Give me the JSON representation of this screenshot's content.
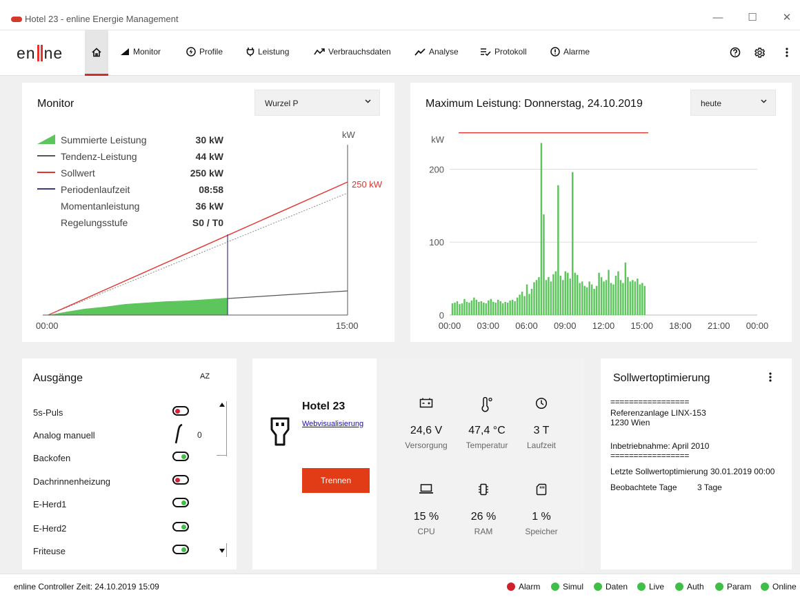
{
  "window": {
    "title": "Hotel 23 - enline Energie Management"
  },
  "nav": {
    "logo_left": "en",
    "logo_right": "ne",
    "items": [
      {
        "label": "Monitor"
      },
      {
        "label": "Profile"
      },
      {
        "label": "Leistung"
      },
      {
        "label": "Verbrauchsdaten"
      },
      {
        "label": "Analyse"
      },
      {
        "label": "Protokoll"
      },
      {
        "label": "Alarme"
      }
    ]
  },
  "monitor": {
    "title": "Monitor",
    "select_value": "Wurzel P",
    "legend": [
      {
        "label": "Summierte Leistung",
        "value": "30 kW"
      },
      {
        "label": "Tendenz-Leistung",
        "value": "44 kW"
      },
      {
        "label": "Sollwert",
        "value": "250 kW"
      },
      {
        "label": "Periodenlaufzeit",
        "value": "08:58"
      },
      {
        "label": "Momentanleistung",
        "value": "36 kW"
      },
      {
        "label": "Regelungsstufe",
        "value": "S0 / T0"
      }
    ],
    "unit": "kW",
    "setpoint_label": "250 kW",
    "x_start": "00:00",
    "x_end": "15:00"
  },
  "max_chart": {
    "title": "Maximum Leistung: Donnerstag, 24.10.2019",
    "select_value": "heute"
  },
  "chart_data": {
    "type": "bar",
    "ylabel": "kW",
    "ylim": [
      0,
      260
    ],
    "y_ticks": [
      "0",
      "100",
      "200"
    ],
    "y_tick_values": [
      0,
      100,
      200
    ],
    "x_ticks": [
      "00:00",
      "03:00",
      "06:00",
      "09:00",
      "12:00",
      "15:00",
      "18:00",
      "21:00",
      "00:00"
    ],
    "x_range_hours": [
      0,
      24
    ],
    "setpoint": 250,
    "setpoint_range_hours": [
      0,
      15.5
    ],
    "values": [
      16,
      17,
      19,
      15,
      16,
      22,
      18,
      17,
      20,
      24,
      21,
      18,
      19,
      17,
      16,
      20,
      22,
      18,
      17,
      21,
      19,
      16,
      18,
      17,
      20,
      21,
      19,
      24,
      28,
      32,
      26,
      42,
      29,
      36,
      45,
      48,
      52,
      236,
      138,
      48,
      52,
      46,
      56,
      60,
      178,
      54,
      48,
      60,
      58,
      50,
      196,
      58,
      55,
      44,
      46,
      40,
      38,
      46,
      42,
      36,
      40,
      58,
      52,
      46,
      48,
      62,
      44,
      42,
      54,
      60,
      48,
      44,
      72,
      52,
      46,
      48,
      46,
      50,
      42,
      44,
      40
    ],
    "bar_hours_start": 0.15,
    "bar_hours_step": 0.1875,
    "bar_color": "#5cc55c",
    "setpoint_color": "#e3312d"
  },
  "outputs": {
    "title": "Ausgänge",
    "sort_icon": "AZ",
    "items": [
      {
        "label": "5s-Puls",
        "state": "off"
      },
      {
        "label": "Analog manuell",
        "value": "0"
      },
      {
        "label": "Backofen",
        "state": "on"
      },
      {
        "label": "Dachrinnenheizung",
        "state": "off"
      },
      {
        "label": "E-Herd1",
        "state": "on"
      },
      {
        "label": "E-Herd2",
        "state": "on"
      },
      {
        "label": "Friteuse",
        "state": "on"
      }
    ]
  },
  "controller": {
    "name": "Hotel 23",
    "link": "Webvisualisierung",
    "button": "Trennen",
    "stats": [
      {
        "value": "24,6 V",
        "label": "Versorgung",
        "icon": "battery-icon"
      },
      {
        "value": "47,4 °C",
        "label": "Temperatur",
        "icon": "thermometer-icon"
      },
      {
        "value": "3 T",
        "label": "Laufzeit",
        "icon": "clock-icon"
      },
      {
        "value": "15 %",
        "label": "CPU",
        "icon": "laptop-icon"
      },
      {
        "value": "26 %",
        "label": "RAM",
        "icon": "memory-icon"
      },
      {
        "value": "1 %",
        "label": "Speicher",
        "icon": "sd-card-icon"
      }
    ]
  },
  "optimization": {
    "title": "Sollwertoptimierung",
    "sep1": "=================",
    "ref": "Referenzanlage LINX-153",
    "city": "1230 Wien",
    "commissioning": "Inbetriebnahme: April 2010",
    "sep2": "=================",
    "last_label": "Letzte Sollwertoptimierung",
    "last_value": "30.01.2019 00:00",
    "days_label": "Beobachtete Tage",
    "days_value": "3 Tage"
  },
  "status": {
    "controller_time": "enline Controller Zeit: 24.10.2019 15:09",
    "indicators": [
      {
        "label": "Alarm",
        "color": "#d0202a"
      },
      {
        "label": "Simul",
        "color": "#3fbf48"
      },
      {
        "label": "Daten",
        "color": "#3fbf48"
      },
      {
        "label": "Live",
        "color": "#3fbf48"
      },
      {
        "label": "Auth",
        "color": "#3fbf48"
      },
      {
        "label": "Param",
        "color": "#3fbf48"
      },
      {
        "label": "Online",
        "color": "#3fbf48"
      }
    ]
  }
}
